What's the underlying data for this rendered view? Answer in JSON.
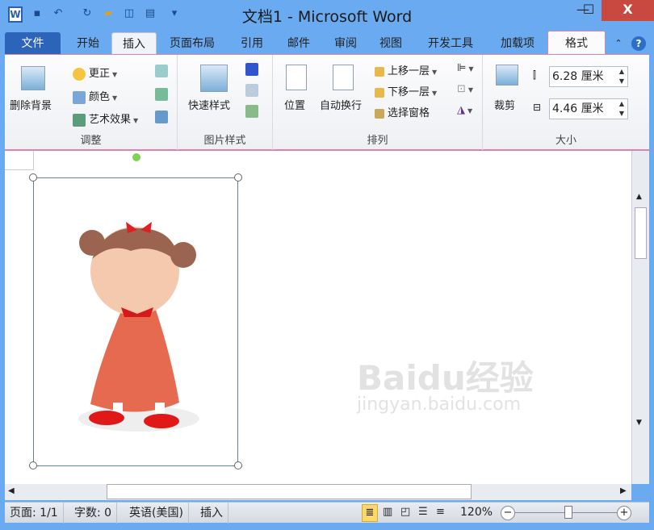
{
  "window": {
    "title": "文档1 - Microsoft Word",
    "app_icon": "W",
    "minimize": "—",
    "maximize": "☐",
    "close": "X"
  },
  "quick_access": [
    "save-icon",
    "undo-icon",
    "redo-icon",
    "open-icon",
    "print-preview-icon",
    "paste-icon",
    "customize-icon"
  ],
  "tabs": [
    "文件",
    "开始",
    "插入",
    "页面布局",
    "引用",
    "邮件",
    "审阅",
    "视图",
    "开发工具",
    "加载项",
    "格式"
  ],
  "active_tab": "格式",
  "ribbon": {
    "adjust": {
      "label": "调整",
      "remove_bg": "删除背景",
      "corrections": "更正",
      "color": "颜色",
      "artistic": "艺术效果"
    },
    "styles": {
      "label": "图片样式",
      "quick_styles": "快速样式"
    },
    "arrange": {
      "label": "排列",
      "position": "位置",
      "wrap": "自动换行",
      "bring_forward": "上移一层",
      "send_backward": "下移一层",
      "selection_pane": "选择窗格"
    },
    "size": {
      "label": "大小",
      "crop": "裁剪",
      "height": "6.28 厘米",
      "width": "4.46 厘米"
    }
  },
  "watermark": {
    "brand": "Baidu经验",
    "url": "jingyan.baidu.com"
  },
  "status": {
    "page": "页面: 1/1",
    "words": "字数: 0",
    "language": "英语(美国)",
    "mode": "插入",
    "zoom": "120%",
    "zoom_level": 0.55
  },
  "help": "?"
}
